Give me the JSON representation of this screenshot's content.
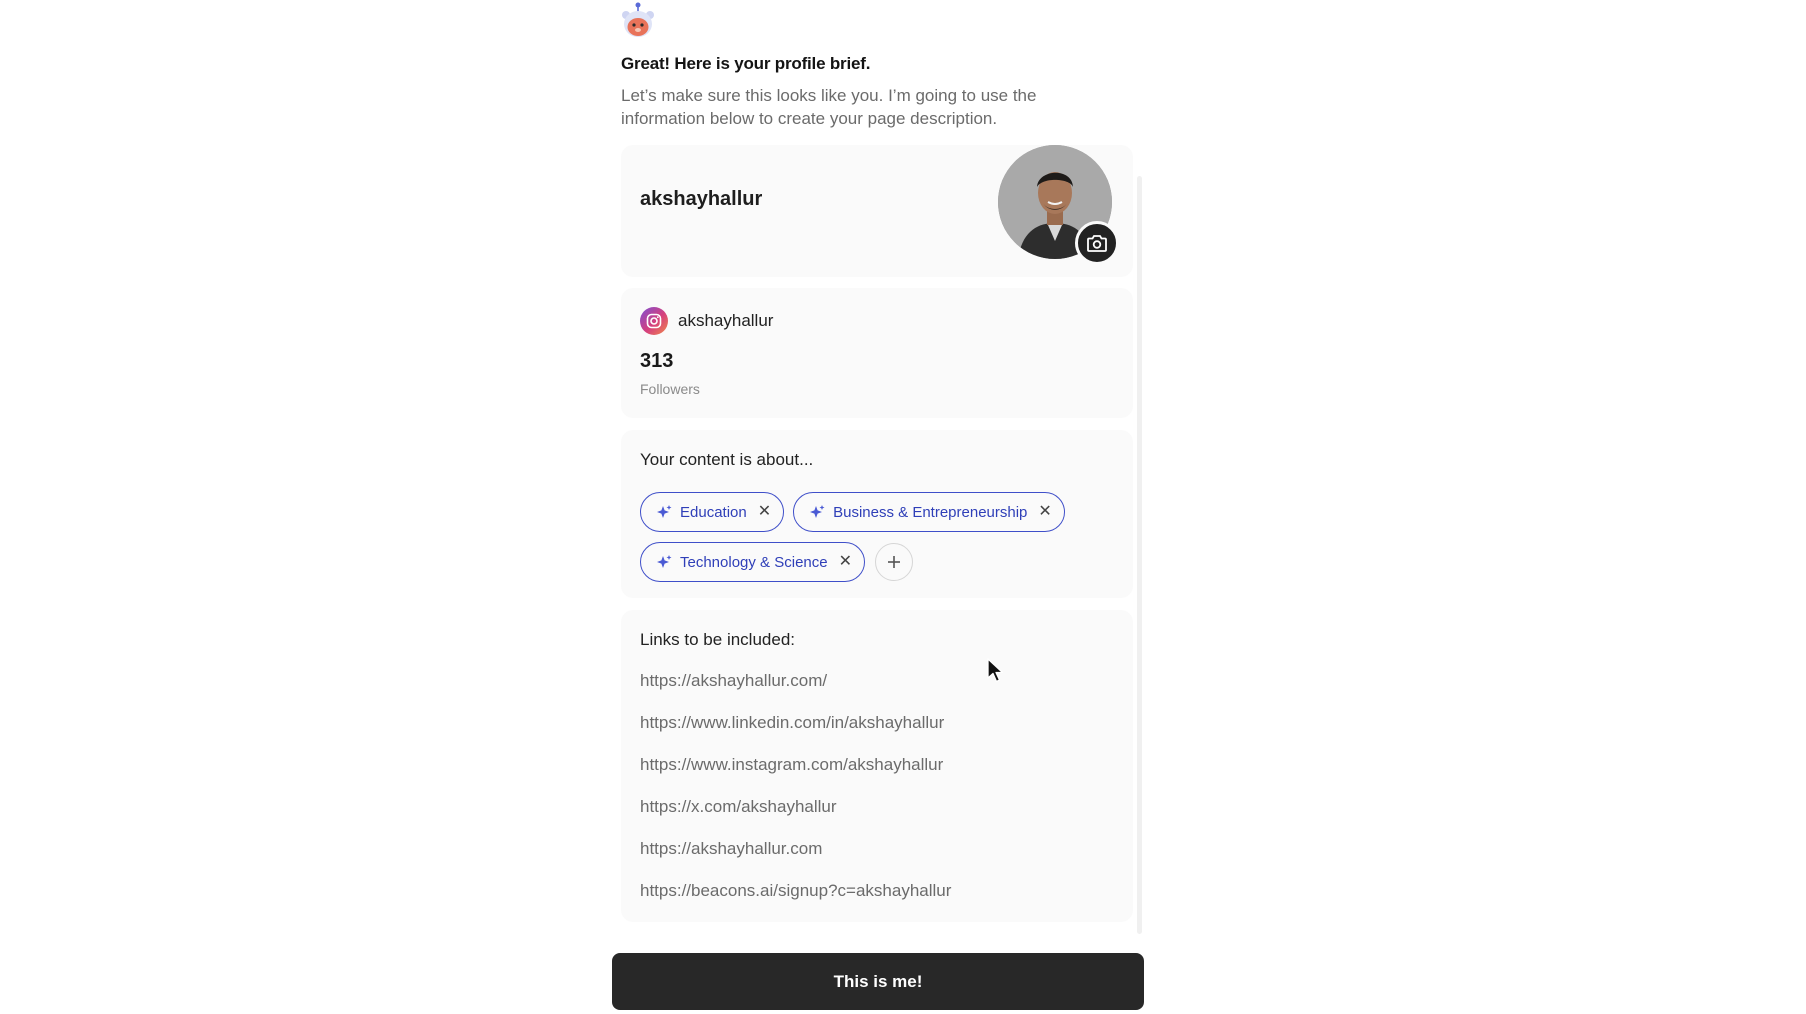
{
  "header": {
    "mascot_icon": "bear-robot-mascot-icon",
    "title": "Great! Here is your profile brief.",
    "subtitle": "Let’s make sure this looks like you. I’m going to use the information below to create your page description."
  },
  "profile": {
    "name": "akshayhallur",
    "avatar_icon": "user-photo",
    "camera_icon": "camera-icon"
  },
  "instagram": {
    "icon": "instagram-icon",
    "handle": "akshayhallur",
    "followers_count": "313",
    "followers_label": "Followers"
  },
  "topics": {
    "title": "Your content is about...",
    "chips": [
      {
        "label": "Education"
      },
      {
        "label": "Business & Entrepreneurship"
      },
      {
        "label": "Technology & Science"
      }
    ],
    "add_icon": "plus-icon"
  },
  "links": {
    "title": "Links to be included:",
    "items": [
      "https://akshayhallur.com/",
      "https://www.linkedin.com/in/akshayhallur",
      "https://www.instagram.com/akshayhallur",
      "https://x.com/akshayhallur",
      "https://akshayhallur.com",
      "https://beacons.ai/signup?c=akshayhallur"
    ]
  },
  "cta": {
    "label": "This is me!"
  },
  "colors": {
    "chip_accent": "#3f4fc9",
    "cta_background": "#282828",
    "card_background": "#fafafa"
  }
}
